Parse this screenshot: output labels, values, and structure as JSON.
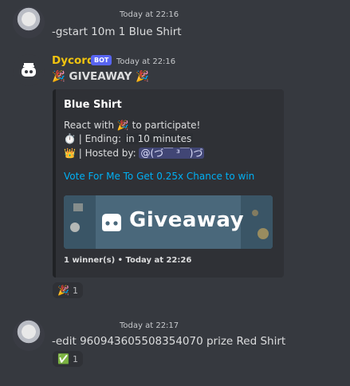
{
  "messages": {
    "first": {
      "timestamp": "Today at 22:16",
      "text": "-gstart 10m 1 Blue Shirt"
    },
    "bot": {
      "username": "Dycord",
      "tag": "BOT",
      "timestamp": "Today at 22:16",
      "headline": "🎉 GIVEAWAY 🎉",
      "embed": {
        "title": "Blue Shirt",
        "line1": "React with 🎉 to participate!",
        "line2_prefix": "⏱️ | Ending: ",
        "line2_value": "in 10 minutes",
        "line3_prefix": "👑 | Hosted by: ",
        "line3_value": "@(づ￣ ³￣)づ",
        "link": "Vote For Me To Get 0.25x Chance to win",
        "banner_text": "Giveaway",
        "footer": "1 winner(s) • Today at 22:26"
      },
      "reaction": {
        "emoji": "🎉",
        "count": "1"
      }
    },
    "third": {
      "timestamp": "Today at 22:17",
      "text": "-edit 960943605508354070 prize Red Shirt",
      "reaction": {
        "emoji": "✅",
        "count": "1"
      }
    }
  },
  "colors": {
    "background": "#36393f",
    "embed_bg": "#2f3136",
    "bot_name": "#f1c40f",
    "bot_tag": "#5865f2",
    "link": "#00b0f4",
    "mention_bg": "#414675"
  },
  "icons": {
    "user_avatar": "anime-avatar",
    "bot_avatar": "discord-bot-avatar",
    "banner_icon": "discord-logo-icon",
    "check": "green-check-emoji"
  }
}
